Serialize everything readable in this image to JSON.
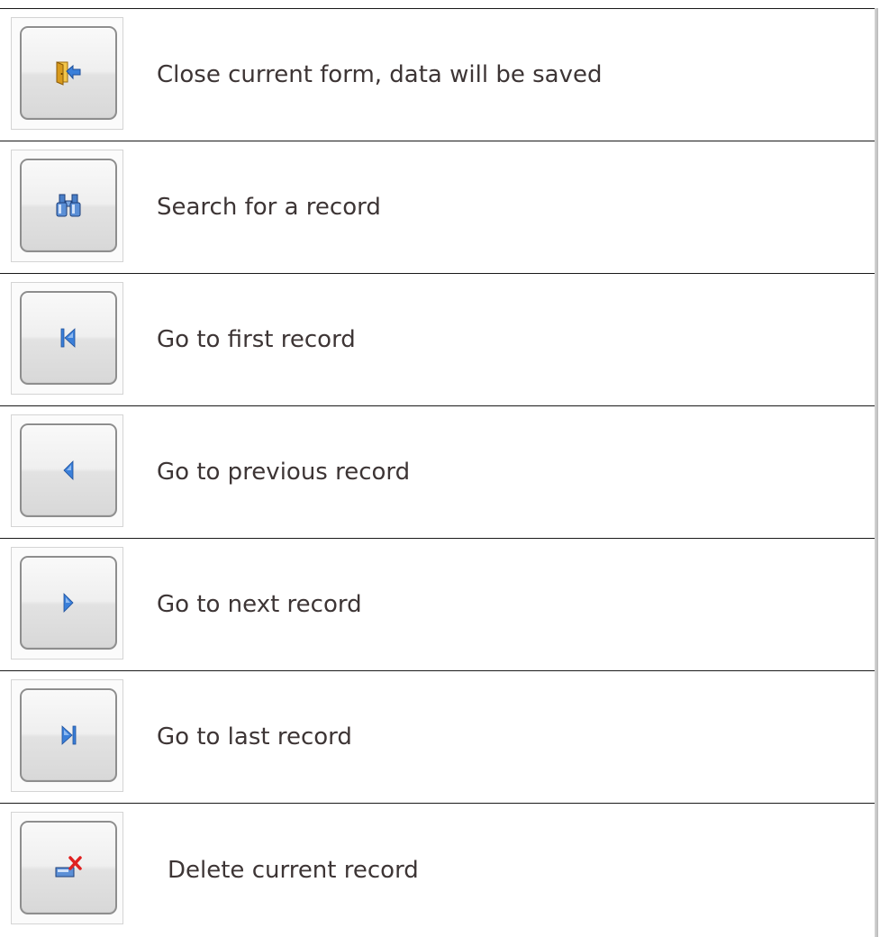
{
  "rows": [
    {
      "id": "close",
      "label": "Close current form, data will be saved",
      "icon": "exit-door-icon"
    },
    {
      "id": "search",
      "label": "Search for a record",
      "icon": "binoculars-icon"
    },
    {
      "id": "first",
      "label": "Go to first record",
      "icon": "first-record-icon"
    },
    {
      "id": "previous",
      "label": "Go to previous record",
      "icon": "previous-record-icon"
    },
    {
      "id": "next",
      "label": "Go to next record",
      "icon": "next-record-icon"
    },
    {
      "id": "last",
      "label": "Go to last record",
      "icon": "last-record-icon"
    },
    {
      "id": "delete",
      "label": "Delete current record",
      "icon": "delete-record-icon"
    }
  ],
  "colors": {
    "text": "#3d3535",
    "icon_blue": "#3a7fd9",
    "delete_red": "#e02020",
    "door_orange": "#d89a1c"
  }
}
